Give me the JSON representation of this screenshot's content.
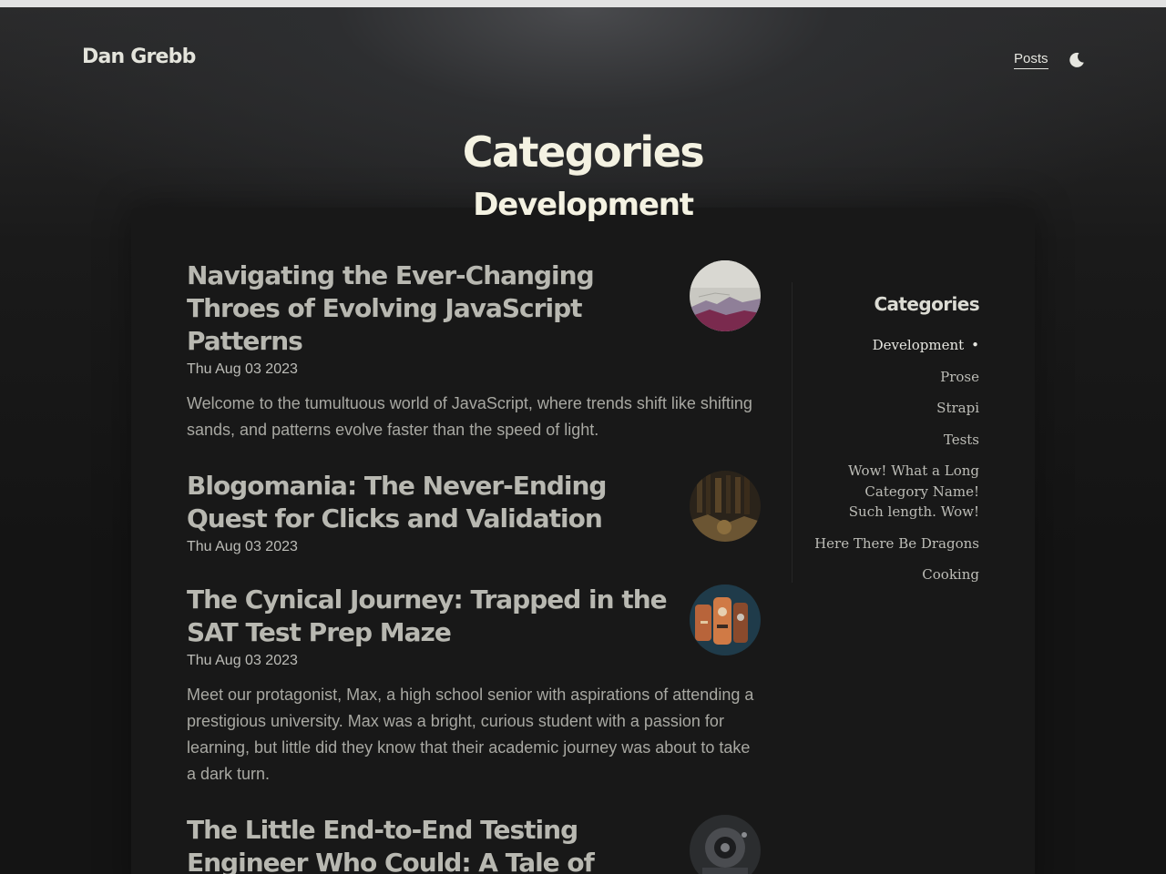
{
  "header": {
    "site_title": "Dan Grebb",
    "nav": [
      {
        "label": "Posts"
      }
    ],
    "theme_toggle_icon": "moon-icon"
  },
  "page": {
    "heading": "Categories",
    "subheading": "Development"
  },
  "posts": [
    {
      "title": "Navigating the Ever-Changing Throes of Evolving JavaScript Patterns",
      "date": "Thu Aug 03 2023",
      "excerpt": "Welcome to the tumultuous world of JavaScript, where trends shift like shifting sands, and patterns evolve faster than the speed of light.",
      "thumbnail_icon": "mountain-thumbnail"
    },
    {
      "title": "Blogomania: The Never-Ending Quest for Clicks and Validation",
      "date": "Thu Aug 03 2023",
      "excerpt": "",
      "thumbnail_icon": "library-thumbnail"
    },
    {
      "title": "The Cynical Journey: Trapped in the SAT Test Prep Maze",
      "date": "Thu Aug 03 2023",
      "excerpt": "Meet our protagonist, Max, a high school senior with aspirations of attending a prestigious university. Max was a bright, curious student with a passion for learning, but little did they know that their academic journey was about to take a dark turn.",
      "thumbnail_icon": "robot-thumbnail"
    },
    {
      "title": "The Little End-to-End Testing Engineer Who Could: A Tale of",
      "date": "",
      "excerpt": "",
      "thumbnail_icon": "machine-thumbnail"
    }
  ],
  "sidebar": {
    "title": "Categories",
    "active_marker": "•",
    "categories": [
      {
        "label": "Development",
        "active": true
      },
      {
        "label": "Prose"
      },
      {
        "label": "Strapi"
      },
      {
        "label": "Tests"
      },
      {
        "label": "Wow! What a Long Category Name! Such length. Wow!"
      },
      {
        "label": "Here There Be Dragons"
      },
      {
        "label": "Cooking"
      }
    ]
  },
  "colors": {
    "background": "#141414",
    "panel": "#181818",
    "heading": "#f4f2e2",
    "post_title": "#b8b8b1",
    "body_text": "#a8a8a2"
  }
}
